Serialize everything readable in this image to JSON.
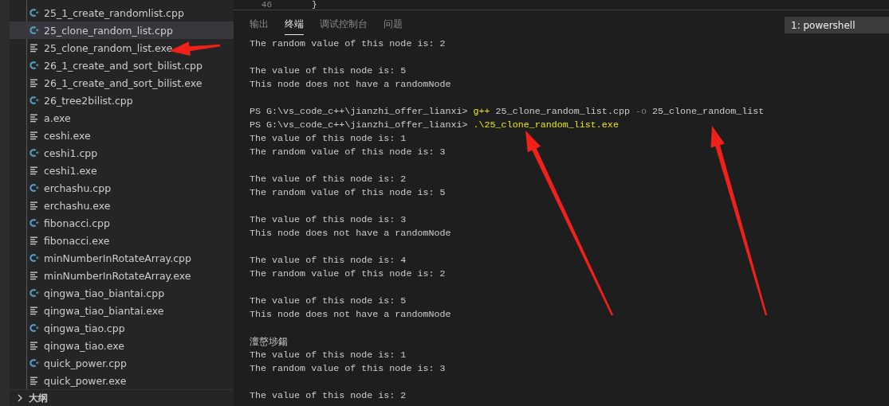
{
  "explorer": {
    "files": [
      {
        "name": "25_1_create_randomlist.cpp",
        "kind": "cpp",
        "selected": false
      },
      {
        "name": "25_clone_random_list.cpp",
        "kind": "cpp",
        "selected": true
      },
      {
        "name": "25_clone_random_list.exe",
        "kind": "exe",
        "selected": false
      },
      {
        "name": "26_1_create_and_sort_bilist.cpp",
        "kind": "cpp",
        "selected": false
      },
      {
        "name": "26_1_create_and_sort_bilist.exe",
        "kind": "exe",
        "selected": false
      },
      {
        "name": "26_tree2bilist.cpp",
        "kind": "cpp",
        "selected": false
      },
      {
        "name": "a.exe",
        "kind": "exe",
        "selected": false
      },
      {
        "name": "ceshi.exe",
        "kind": "exe",
        "selected": false
      },
      {
        "name": "ceshi1.cpp",
        "kind": "cpp",
        "selected": false
      },
      {
        "name": "ceshi1.exe",
        "kind": "exe",
        "selected": false
      },
      {
        "name": "erchashu.cpp",
        "kind": "cpp",
        "selected": false
      },
      {
        "name": "erchashu.exe",
        "kind": "exe",
        "selected": false
      },
      {
        "name": "fibonacci.cpp",
        "kind": "cpp",
        "selected": false
      },
      {
        "name": "fibonacci.exe",
        "kind": "exe",
        "selected": false
      },
      {
        "name": "minNumberInRotateArray.cpp",
        "kind": "cpp",
        "selected": false
      },
      {
        "name": "minNumberInRotateArray.exe",
        "kind": "exe",
        "selected": false
      },
      {
        "name": "qingwa_tiao_biantai.cpp",
        "kind": "cpp",
        "selected": false
      },
      {
        "name": "qingwa_tiao_biantai.exe",
        "kind": "exe",
        "selected": false
      },
      {
        "name": "qingwa_tiao.cpp",
        "kind": "cpp",
        "selected": false
      },
      {
        "name": "qingwa_tiao.exe",
        "kind": "exe",
        "selected": false
      },
      {
        "name": "quick_power.cpp",
        "kind": "cpp",
        "selected": false
      },
      {
        "name": "quick_power.exe",
        "kind": "exe",
        "selected": false
      }
    ],
    "outline": {
      "label": "大纲",
      "expanded": false
    }
  },
  "editor": {
    "line_number": "46",
    "code": "}"
  },
  "panel": {
    "tabs": [
      {
        "label": "输出",
        "selected": false
      },
      {
        "label": "终端",
        "selected": true
      },
      {
        "label": "调试控制台",
        "selected": false
      },
      {
        "label": "问题",
        "selected": false
      }
    ],
    "terminal_select": "1: powershell",
    "lines": [
      {
        "kind": "output",
        "text": "The random value of this node is: 2"
      },
      {
        "kind": "blank"
      },
      {
        "kind": "output",
        "text": "The value of this node is: 5"
      },
      {
        "kind": "output",
        "text": "This node does not have a randomNode"
      },
      {
        "kind": "blank"
      },
      {
        "kind": "command",
        "prompt": "PS G:\\vs_code_c++\\jianzhi_offer_lianxi> ",
        "parts": [
          {
            "kind": "exec",
            "text": "g++"
          },
          {
            "kind": "arg",
            "text": " 25_clone_random_list.cpp"
          },
          {
            "kind": "flag",
            "text": " -o"
          },
          {
            "kind": "arg",
            "text": " 25_clone_random_list"
          }
        ]
      },
      {
        "kind": "command",
        "prompt": "PS G:\\vs_code_c++\\jianzhi_offer_lianxi> ",
        "parts": [
          {
            "kind": "exec",
            "text": ".\\25_clone_random_list.exe"
          }
        ]
      },
      {
        "kind": "output",
        "text": "The value of this node is: 1"
      },
      {
        "kind": "output",
        "text": "The random value of this node is: 3"
      },
      {
        "kind": "blank"
      },
      {
        "kind": "output",
        "text": "The value of this node is: 2"
      },
      {
        "kind": "output",
        "text": "The random value of this node is: 5"
      },
      {
        "kind": "blank"
      },
      {
        "kind": "output",
        "text": "The value of this node is: 3"
      },
      {
        "kind": "output",
        "text": "This node does not have a randomNode"
      },
      {
        "kind": "blank"
      },
      {
        "kind": "output",
        "text": "The value of this node is: 4"
      },
      {
        "kind": "output",
        "text": "The random value of this node is: 2"
      },
      {
        "kind": "blank"
      },
      {
        "kind": "output",
        "text": "The value of this node is: 5"
      },
      {
        "kind": "output",
        "text": "This node does not have a randomNode"
      },
      {
        "kind": "blank"
      },
      {
        "kind": "output",
        "text": "澶嶅埗鍚"
      },
      {
        "kind": "output",
        "text": "The value of this node is: 1"
      },
      {
        "kind": "output",
        "text": "The random value of this node is: 3"
      },
      {
        "kind": "blank"
      },
      {
        "kind": "output",
        "text": "The value of this node is: 2"
      }
    ]
  }
}
